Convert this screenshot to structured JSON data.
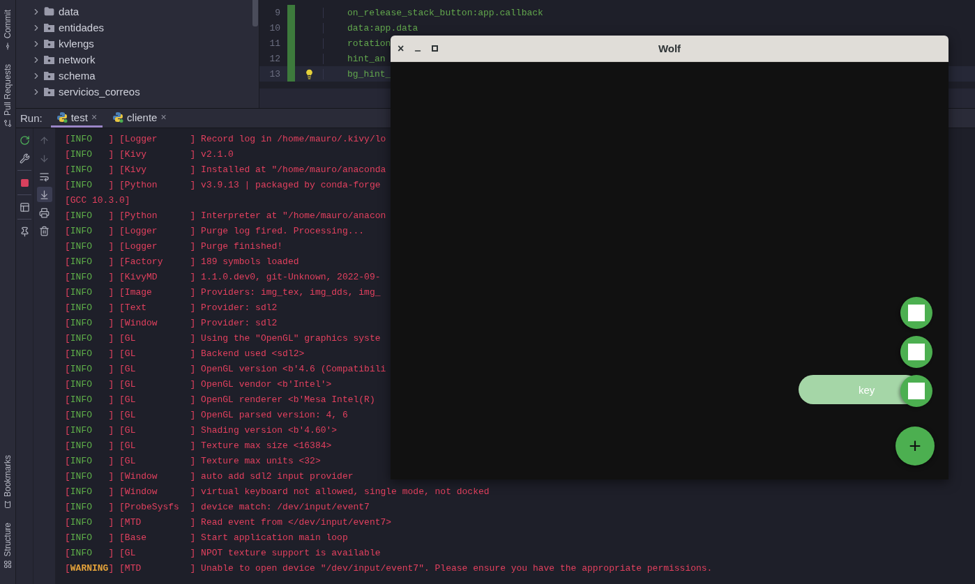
{
  "sidebar_tabs": [
    {
      "label": "Commit",
      "kind": "commit"
    },
    {
      "label": "Pull Requests",
      "kind": "pull_requests"
    },
    {
      "label": "Bookmarks",
      "kind": "bookmarks"
    },
    {
      "label": "Structure",
      "kind": "structure"
    }
  ],
  "project_tree": {
    "items": [
      {
        "label": "data",
        "kind": "folder",
        "expanded": false
      },
      {
        "label": "entidades",
        "kind": "package",
        "expanded": false
      },
      {
        "label": "kvlengs",
        "kind": "package",
        "expanded": false
      },
      {
        "label": "network",
        "kind": "package",
        "expanded": false
      },
      {
        "label": "schema",
        "kind": "package",
        "expanded": false
      },
      {
        "label": "servicios_correos",
        "kind": "package",
        "expanded": false
      }
    ]
  },
  "editor": {
    "lines": [
      {
        "number": "9",
        "code": "on_release_stack_button:app.callback",
        "current": false,
        "bulb": false
      },
      {
        "number": "10",
        "code": "data:app.data",
        "current": false,
        "bulb": false
      },
      {
        "number": "11",
        "code": "rotation",
        "current": false,
        "bulb": false
      },
      {
        "number": "12",
        "code": "hint_an",
        "current": false,
        "bulb": false
      },
      {
        "number": "13",
        "code": "bg_hint_",
        "current": true,
        "bulb": true
      }
    ]
  },
  "run_panel": {
    "label": "Run:",
    "tabs": [
      {
        "label": "test",
        "selected": true,
        "close": "×"
      },
      {
        "label": "cliente",
        "selected": false,
        "close": "×"
      }
    ],
    "toggles": [
      {
        "kind": "soft_wrap",
        "on": false
      },
      {
        "kind": "scroll_to_end",
        "on": true
      }
    ]
  },
  "log": [
    {
      "kind": "info",
      "level": "[INFO   ]",
      "logger": "[Logger      ]",
      "message": "Record log in /home/mauro/.kivy/lo"
    },
    {
      "kind": "info",
      "level": "[INFO   ]",
      "logger": "[Kivy        ]",
      "message": "v2.1.0"
    },
    {
      "kind": "info",
      "level": "[INFO   ]",
      "logger": "[Kivy        ]",
      "message": "Installed at \"/home/mauro/anaconda"
    },
    {
      "kind": "info",
      "level": "[INFO   ]",
      "logger": "[Python      ]",
      "message": "v3.9.13 | packaged by conda-forge"
    },
    {
      "kind": "continuation",
      "message": "[GCC 10.3.0]"
    },
    {
      "kind": "info",
      "level": "[INFO   ]",
      "logger": "[Python      ]",
      "message": "Interpreter at \"/home/mauro/anacon"
    },
    {
      "kind": "info",
      "level": "[INFO   ]",
      "logger": "[Logger      ]",
      "message": "Purge log fired. Processing..."
    },
    {
      "kind": "info",
      "level": "[INFO   ]",
      "logger": "[Logger      ]",
      "message": "Purge finished!"
    },
    {
      "kind": "info",
      "level": "[INFO   ]",
      "logger": "[Factory     ]",
      "message": "189 symbols loaded"
    },
    {
      "kind": "info",
      "level": "[INFO   ]",
      "logger": "[KivyMD      ]",
      "message": "1.1.0.dev0, git-Unknown, 2022-09-"
    },
    {
      "kind": "info",
      "level": "[INFO   ]",
      "logger": "[Image       ]",
      "message": "Providers: img_tex, img_dds, img_"
    },
    {
      "kind": "info",
      "level": "[INFO   ]",
      "logger": "[Text        ]",
      "message": "Provider: sdl2"
    },
    {
      "kind": "info",
      "level": "[INFO   ]",
      "logger": "[Window      ]",
      "message": "Provider: sdl2"
    },
    {
      "kind": "info",
      "level": "[INFO   ]",
      "logger": "[GL          ]",
      "message": "Using the \"OpenGL\" graphics syste"
    },
    {
      "kind": "info",
      "level": "[INFO   ]",
      "logger": "[GL          ]",
      "message": "Backend used <sdl2>"
    },
    {
      "kind": "info",
      "level": "[INFO   ]",
      "logger": "[GL          ]",
      "message": "OpenGL version <b'4.6 (Compatibili"
    },
    {
      "kind": "info",
      "level": "[INFO   ]",
      "logger": "[GL          ]",
      "message": "OpenGL vendor <b'Intel'>"
    },
    {
      "kind": "info",
      "level": "[INFO   ]",
      "logger": "[GL          ]",
      "message": "OpenGL renderer <b'Mesa Intel(R)"
    },
    {
      "kind": "info",
      "level": "[INFO   ]",
      "logger": "[GL          ]",
      "message": "OpenGL parsed version: 4, 6"
    },
    {
      "kind": "info",
      "level": "[INFO   ]",
      "logger": "[GL          ]",
      "message": "Shading version <b'4.60'>"
    },
    {
      "kind": "info",
      "level": "[INFO   ]",
      "logger": "[GL          ]",
      "message": "Texture max size <16384>"
    },
    {
      "kind": "info",
      "level": "[INFO   ]",
      "logger": "[GL          ]",
      "message": "Texture max units <32>"
    },
    {
      "kind": "info",
      "level": "[INFO   ]",
      "logger": "[Window      ]",
      "message": "auto add sdl2 input provider"
    },
    {
      "kind": "info",
      "level": "[INFO   ]",
      "logger": "[Window      ]",
      "message": "virtual keyboard not allowed, single mode, not docked"
    },
    {
      "kind": "info",
      "level": "[INFO   ]",
      "logger": "[ProbeSysfs  ]",
      "message": "device match: /dev/input/event7"
    },
    {
      "kind": "info",
      "level": "[INFO   ]",
      "logger": "[MTD         ]",
      "message": "Read event from </dev/input/event7>"
    },
    {
      "kind": "info",
      "level": "[INFO   ]",
      "logger": "[Base        ]",
      "message": "Start application main loop"
    },
    {
      "kind": "info",
      "level": "[INFO   ]",
      "logger": "[GL          ]",
      "message": "NPOT texture support is available"
    },
    {
      "kind": "warning",
      "level": "[WARNING]",
      "logger": "[MTD         ]",
      "message": "Unable to open device \"/dev/input/event7\". Please ensure you have the appropriate permissions."
    }
  ],
  "app_window": {
    "title": "Wolf",
    "close": "×",
    "speed_dial": {
      "actions": [
        {
          "hint_shown": false
        },
        {
          "hint_shown": false
        },
        {
          "hint_shown": true,
          "hint": "key"
        }
      ],
      "main_button": "+"
    }
  }
}
